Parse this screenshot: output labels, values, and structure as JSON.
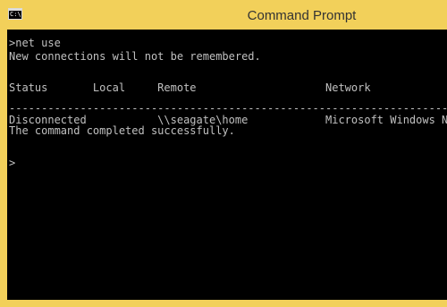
{
  "window": {
    "title": "Command Prompt",
    "icon": "console-app-icon",
    "icon_text": "C:\\.",
    "frame_color": "#f2d05a",
    "console_bg": "#000000",
    "console_fg": "#c0c0c0"
  },
  "console": {
    "lines": [
      ">net use",
      "New connections will not be remembered.",
      "",
      "",
      "Status       Local     Remote                    Network",
      "",
      "-------------------------------------------------------------------------------",
      "Disconnected           \\\\seagate\\home            Microsoft Windows Network",
      "The command completed successfully.",
      "",
      "",
      ">"
    ]
  }
}
